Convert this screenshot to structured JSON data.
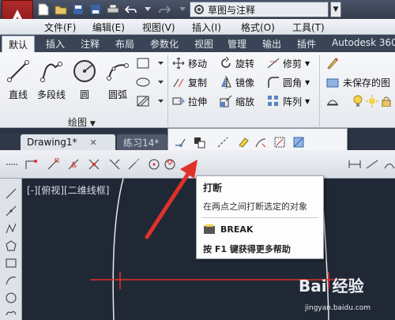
{
  "title_bar": {
    "workspace": "草图与注释"
  },
  "menu": {
    "items": [
      "文件(F)",
      "编辑(E)",
      "视图(V)",
      "插入(I)",
      "格式(O)",
      "工具(T)"
    ]
  },
  "ribbon": {
    "tabs": [
      "默认",
      "插入",
      "注释",
      "布局",
      "参数化",
      "视图",
      "管理",
      "输出",
      "插件",
      "Autodesk 360"
    ],
    "draw_panel": {
      "label": "绘图",
      "tools": [
        "直线",
        "多段线",
        "圆",
        "圆弧"
      ]
    },
    "modify_panel": {
      "tools": [
        "移动",
        "旋转",
        "修剪",
        "复制",
        "镜像",
        "圆角",
        "拉伸",
        "缩放",
        "阵列"
      ]
    },
    "layer_panel": {
      "state_text": "未保存的图"
    }
  },
  "doc_tabs": [
    "Drawing1*",
    "练习14*"
  ],
  "viewport": {
    "label": "[-][俯视][二维线框]"
  },
  "tooltip": {
    "title": "打断",
    "description": "在两点之间打断选定的对象",
    "command": "BREAK",
    "help": "按 F1 键获得更多帮助"
  },
  "watermark": {
    "text": "Bai 经验",
    "url": "jingyan.baidu.com"
  },
  "colors": {
    "accent_red": "#e0302a",
    "canvas": "#212835",
    "highlight": "#3a86d4"
  }
}
